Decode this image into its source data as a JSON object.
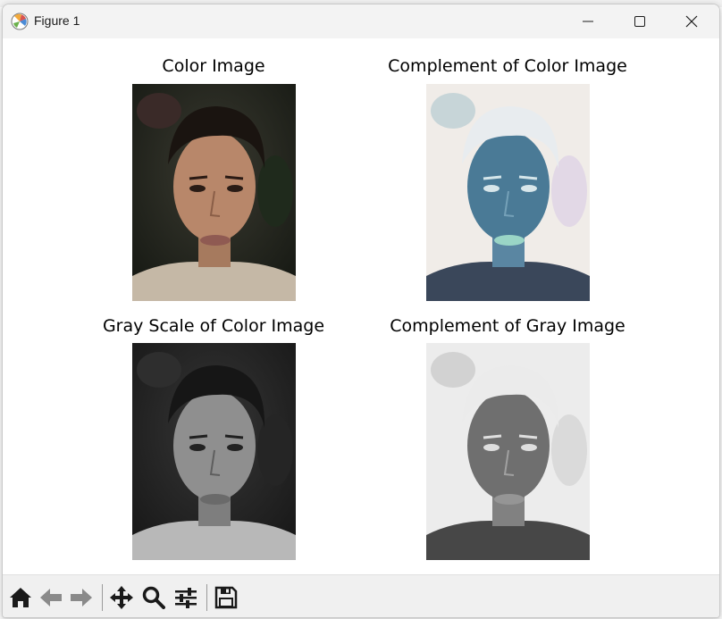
{
  "window": {
    "title": "Figure 1",
    "minimize_icon": "minimize-icon",
    "maximize_icon": "maximize-icon",
    "close_icon": "close-icon"
  },
  "subplots": [
    {
      "title": "Color Image",
      "variant": "color"
    },
    {
      "title": "Complement of Color Image",
      "variant": "color-complement"
    },
    {
      "title": "Gray Scale of Color Image",
      "variant": "gray"
    },
    {
      "title": "Complement of Gray Image",
      "variant": "gray-complement"
    }
  ],
  "toolbar": {
    "icons": [
      "home-icon",
      "back-icon",
      "forward-icon",
      "pan-icon",
      "zoom-icon",
      "configure-subplots-icon",
      "save-icon"
    ]
  },
  "colors": {
    "titlebar": "#f3f3f3",
    "toolbar": "#f0f0f0",
    "icon": "#1a1a1a"
  }
}
